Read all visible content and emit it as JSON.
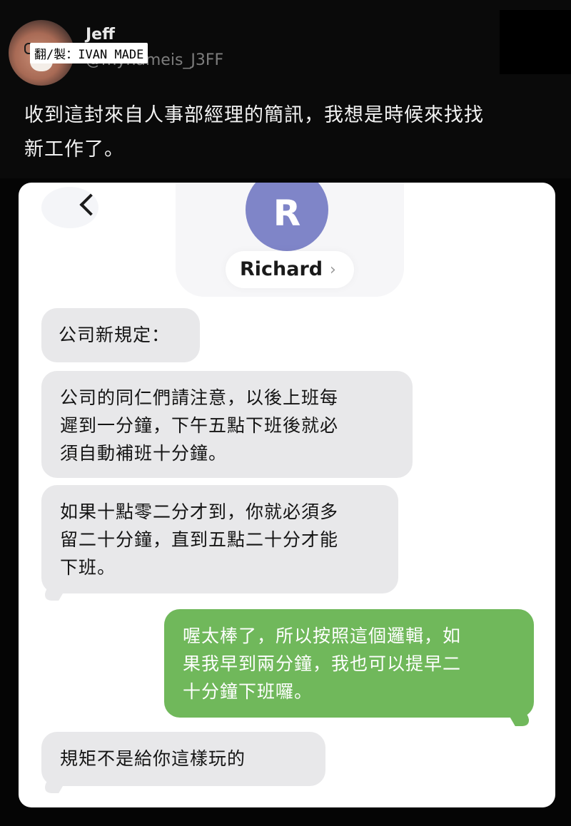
{
  "post": {
    "display_name": "Jeff",
    "handle": "@mynameis_J3FF",
    "credit": "翻/製：IVAN MADE",
    "text_line1": "收到這封來自人事部經理的簡訊，我想是時候來找找",
    "text_line2": "新工作了。"
  },
  "conversation": {
    "contact_initial": "R",
    "contact_name": "Richard",
    "contact_chevron": "›",
    "messages": [
      {
        "direction": "incoming",
        "lines": [
          "公司新規定："
        ]
      },
      {
        "direction": "incoming",
        "lines": [
          "公司的同仁們請注意，以後上班每",
          "遲到一分鐘，下午五點下班後就必",
          "須自動補班十分鐘。"
        ]
      },
      {
        "direction": "incoming",
        "lines": [
          "如果十點零二分才到，你就必須多",
          "留二十分鐘，直到五點二十分才能",
          "下班。"
        ]
      },
      {
        "direction": "outgoing",
        "lines": [
          "喔太棒了，所以按照這個邏輯，如",
          "果我早到兩分鐘，我也可以提早二",
          "十分鐘下班囉。"
        ]
      },
      {
        "direction": "incoming",
        "lines": [
          "規矩不是給你這樣玩的"
        ]
      }
    ]
  },
  "colors": {
    "incoming_bubble": "#e8e8ea",
    "outgoing_bubble": "#70b85b",
    "contact_avatar": "#7f85c8"
  }
}
